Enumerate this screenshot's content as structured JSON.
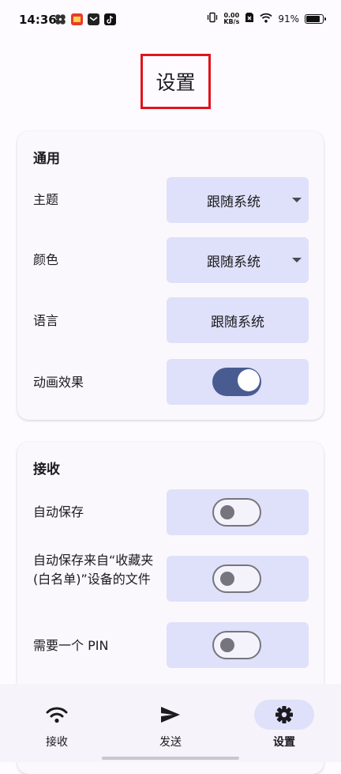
{
  "status_bar": {
    "time": "14:36",
    "net_speed_value": "0.00",
    "net_speed_unit": "KB/s",
    "battery": "91%",
    "battery_level": 0.91
  },
  "page": {
    "title": "设置"
  },
  "general": {
    "title": "通用",
    "theme": {
      "label": "主题",
      "value": "跟随系统"
    },
    "color": {
      "label": "颜色",
      "value": "跟随系统"
    },
    "language": {
      "label": "语言",
      "value": "跟随系统"
    },
    "animation": {
      "label": "动画效果",
      "enabled": true
    }
  },
  "receive": {
    "title": "接收",
    "auto_save": {
      "label": "自动保存",
      "enabled": false
    },
    "auto_save_favorites": {
      "label": "自动保存来自“收藏夹(白名单)”设备的文件",
      "enabled": false
    },
    "require_pin": {
      "label": "需要一个 PIN",
      "enabled": false
    }
  },
  "nav": {
    "items": [
      {
        "label": "接收",
        "icon": "wifi-icon",
        "active": false
      },
      {
        "label": "发送",
        "icon": "send-icon",
        "active": false
      },
      {
        "label": "设置",
        "icon": "gear-icon",
        "active": true
      }
    ]
  },
  "colors": {
    "accent": "#495c92",
    "control_bg": "#dfe0f9",
    "highlight_box": "#e0141b"
  }
}
